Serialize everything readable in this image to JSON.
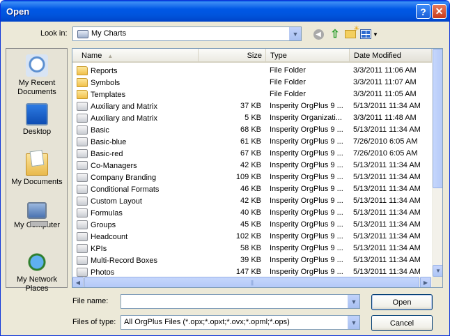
{
  "window": {
    "title": "Open"
  },
  "titlebar": {
    "help_glyph": "?",
    "close_glyph": "✕"
  },
  "toolbar": {
    "look_in_label": "Look in:",
    "look_in_value": "My Charts",
    "back_icon": "back-arrow-icon",
    "up_icon": "up-folder-icon",
    "new_folder_icon": "new-folder-icon",
    "views_icon": "views-menu-icon"
  },
  "places": [
    {
      "label": "My Recent Documents",
      "icon": "recent-documents-icon"
    },
    {
      "label": "Desktop",
      "icon": "desktop-icon"
    },
    {
      "label": "My Documents",
      "icon": "my-documents-icon"
    },
    {
      "label": "My Computer",
      "icon": "my-computer-icon"
    },
    {
      "label": "My Network Places",
      "icon": "network-places-icon"
    }
  ],
  "columns": {
    "name": "Name",
    "size": "Size",
    "type": "Type",
    "date": "Date Modified"
  },
  "files": [
    {
      "name": "Reports",
      "size": "",
      "type": "File Folder",
      "date": "3/3/2011 11:06 AM",
      "kind": "folder"
    },
    {
      "name": "Symbols",
      "size": "",
      "type": "File Folder",
      "date": "3/3/2011 11:07 AM",
      "kind": "folder"
    },
    {
      "name": "Templates",
      "size": "",
      "type": "File Folder",
      "date": "3/3/2011 11:05 AM",
      "kind": "folder"
    },
    {
      "name": "Auxiliary and Matrix",
      "size": "37 KB",
      "type": "Insperity OrgPlus 9 ...",
      "date": "5/13/2011 11:34 AM",
      "kind": "chart"
    },
    {
      "name": "Auxiliary and Matrix",
      "size": "5 KB",
      "type": "Insperity Organizati...",
      "date": "3/3/2011 11:48 AM",
      "kind": "chart"
    },
    {
      "name": "Basic",
      "size": "68 KB",
      "type": "Insperity OrgPlus 9 ...",
      "date": "5/13/2011 11:34 AM",
      "kind": "chart"
    },
    {
      "name": "Basic-blue",
      "size": "61 KB",
      "type": "Insperity OrgPlus 9 ...",
      "date": "7/26/2010 6:05 AM",
      "kind": "chart"
    },
    {
      "name": "Basic-red",
      "size": "67 KB",
      "type": "Insperity OrgPlus 9 ...",
      "date": "7/26/2010 6:05 AM",
      "kind": "chart"
    },
    {
      "name": "Co-Managers",
      "size": "42 KB",
      "type": "Insperity OrgPlus 9 ...",
      "date": "5/13/2011 11:34 AM",
      "kind": "chart"
    },
    {
      "name": "Company Branding",
      "size": "109 KB",
      "type": "Insperity OrgPlus 9 ...",
      "date": "5/13/2011 11:34 AM",
      "kind": "chart"
    },
    {
      "name": "Conditional Formats",
      "size": "46 KB",
      "type": "Insperity OrgPlus 9 ...",
      "date": "5/13/2011 11:34 AM",
      "kind": "chart"
    },
    {
      "name": "Custom Layout",
      "size": "42 KB",
      "type": "Insperity OrgPlus 9 ...",
      "date": "5/13/2011 11:34 AM",
      "kind": "chart"
    },
    {
      "name": "Formulas",
      "size": "40 KB",
      "type": "Insperity OrgPlus 9 ...",
      "date": "5/13/2011 11:34 AM",
      "kind": "chart"
    },
    {
      "name": "Groups",
      "size": "45 KB",
      "type": "Insperity OrgPlus 9 ...",
      "date": "5/13/2011 11:34 AM",
      "kind": "chart"
    },
    {
      "name": "Headcount",
      "size": "102 KB",
      "type": "Insperity OrgPlus 9 ...",
      "date": "5/13/2011 11:34 AM",
      "kind": "chart"
    },
    {
      "name": "KPIs",
      "size": "58 KB",
      "type": "Insperity OrgPlus 9 ...",
      "date": "5/13/2011 11:34 AM",
      "kind": "chart"
    },
    {
      "name": "Multi-Record Boxes",
      "size": "39 KB",
      "type": "Insperity OrgPlus 9 ...",
      "date": "5/13/2011 11:34 AM",
      "kind": "chart"
    },
    {
      "name": "Photos",
      "size": "147 KB",
      "type": "Insperity OrgPlus 9 ...",
      "date": "5/13/2011 11:34 AM",
      "kind": "chart"
    }
  ],
  "bottom": {
    "file_name_label": "File name:",
    "file_name_value": "",
    "file_type_label": "Files of type:",
    "file_type_value": "All OrgPlus Files (*.opx;*.opxt;*.ovx;*.opml;*.ops)",
    "open_button": "Open",
    "cancel_button": "Cancel"
  }
}
